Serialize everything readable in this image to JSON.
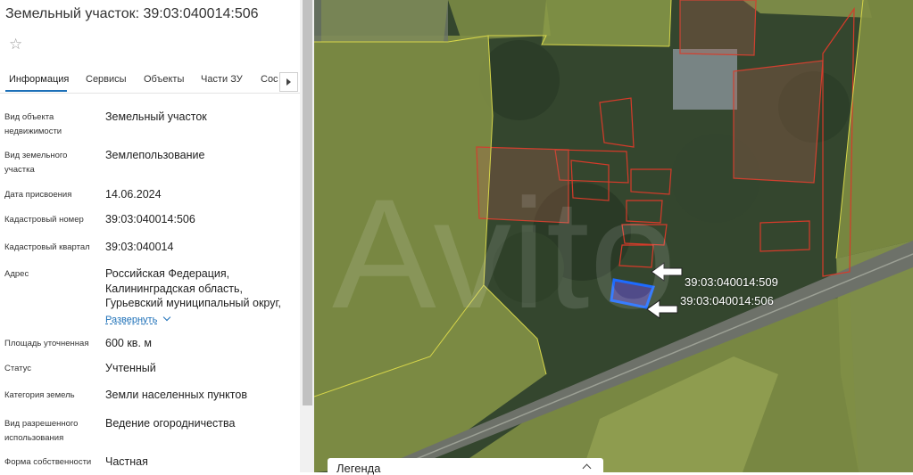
{
  "panel": {
    "title": "Земельный участок: 39:03:040014:506",
    "tabs": [
      "Информация",
      "Сервисы",
      "Объекты",
      "Части ЗУ",
      "Сос"
    ],
    "rows": [
      {
        "label": "Вид объекта недвижимости",
        "value": "Земельный участок"
      },
      {
        "label": "Вид земельного участка",
        "value": "Землепользование"
      },
      {
        "label": "Дата присвоения",
        "value": "14.06.2024"
      },
      {
        "label": "Кадастровый номер",
        "value": "39:03:040014:506"
      },
      {
        "label": "Кадастровый квартал",
        "value": "39:03:040014"
      },
      {
        "label": "Адрес",
        "value_lines": [
          "Российская Федерация,",
          "Калининградская область,",
          "Гурьевский муниципальный округ,"
        ],
        "link": "Развернуть"
      },
      {
        "label": "Площадь уточненная",
        "value": "600 кв. м"
      },
      {
        "label": "Статус",
        "value": "Учтенный"
      },
      {
        "label": "Категория земель",
        "value": "Земли населенных пунктов"
      },
      {
        "label": "Вид разрешенного использования",
        "value": "Ведение огородничества"
      },
      {
        "label": "Форма собственности",
        "value": "Частная"
      }
    ]
  },
  "map": {
    "annotations": [
      "39:03:040014:509",
      "39:03:040014:506"
    ],
    "legend": "Легенда"
  }
}
